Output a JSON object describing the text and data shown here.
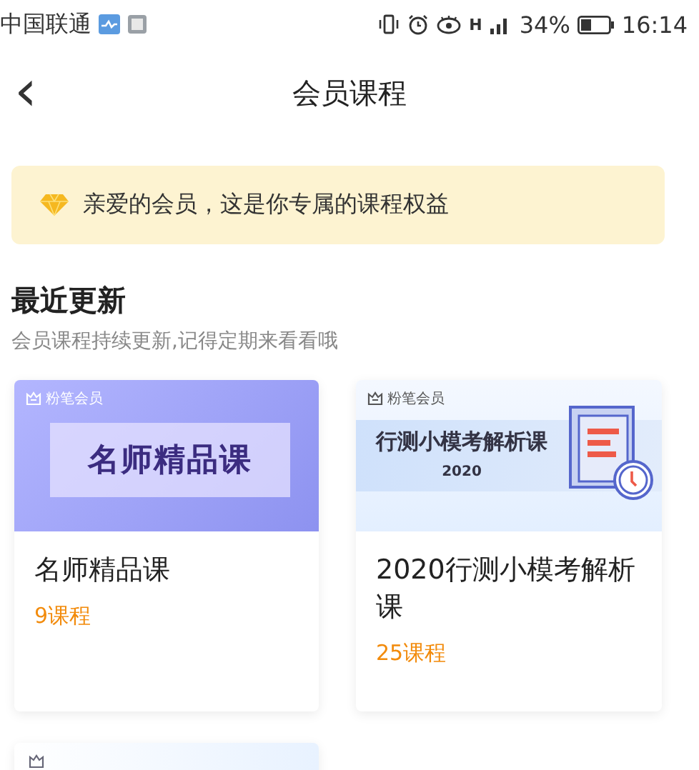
{
  "status_bar": {
    "carrier": "中国联通",
    "battery_percent": "34%",
    "time": "16:14",
    "network_label": "H"
  },
  "header": {
    "back": "‹",
    "title": "会员课程"
  },
  "notice": {
    "text": "亲爱的会员，这是你专属的课程权益"
  },
  "section": {
    "title": "最近更新",
    "subtitle": "会员课程持续更新,记得定期来看看哦"
  },
  "courses": [
    {
      "kind": "purple",
      "brand": "粉笔会员",
      "banner_title": "名师精品课",
      "name": "名师精品课",
      "count": "9课程"
    },
    {
      "kind": "blue",
      "brand": "粉笔会员",
      "banner_title": "行测小模考解析课",
      "banner_year": "2020",
      "name": "2020行测小模考解析课",
      "count": "25课程"
    }
  ]
}
